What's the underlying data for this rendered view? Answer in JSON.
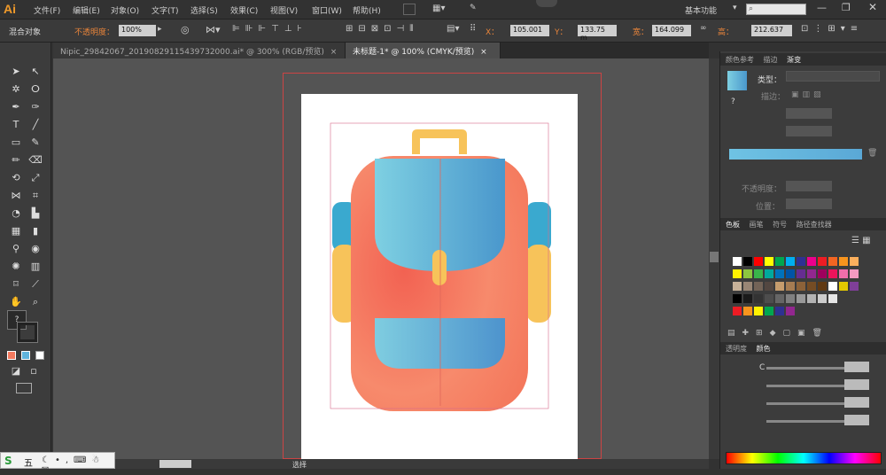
{
  "menu": {
    "logo": "Ai",
    "items": [
      "文件(F)",
      "编辑(E)",
      "对象(O)",
      "文字(T)",
      "选择(S)",
      "效果(C)",
      "视图(V)",
      "窗口(W)",
      "帮助(H)"
    ],
    "workspace": "基本功能",
    "search_placeholder": ""
  },
  "control": {
    "selection_label": "混合对象",
    "opacity_label": "不透明度：",
    "opacity_value": "100%",
    "x_label": "X：",
    "x_value": "105.001",
    "y_label": "Y：",
    "y_value": "133.75 m",
    "w_label": "宽：",
    "w_value": "164.099",
    "h_label": "高：",
    "h_value": "212.637"
  },
  "tabs": [
    {
      "label": "Nipic_29842067_20190829115439732000.ai* @ 300% (RGB/预览)",
      "close": "×"
    },
    {
      "label": "未标题-1* @ 100% (CMYK/预览)",
      "close": "×"
    }
  ],
  "gradient_panel": {
    "tabs": [
      "颜色参考",
      "描边",
      "渐变"
    ],
    "type_label": "类型：",
    "stroke_label": "描边：",
    "opacity_label": "不透明度：",
    "position_label": "位置：",
    "question": "?"
  },
  "swatches_panel": {
    "tabs": [
      "色板",
      "画笔",
      "符号",
      "路径查找器"
    ]
  },
  "color_panel": {
    "tabs": [
      "透明度",
      "颜色"
    ],
    "channel_c": "C"
  },
  "status": {
    "tool_label": "选择"
  },
  "taskbar": {
    "ime": "五"
  },
  "colors": {
    "bag_body": "#f47a5f",
    "bag_pocket": "#5fb4dd",
    "bag_strap": "#f7c35a",
    "side_top": "#3aa9cf"
  },
  "swatch_rows": [
    [
      "#ffffff",
      "#000000",
      "#ff0000",
      "#ffff00",
      "#00a650",
      "#00aeef",
      "#2e3192",
      "#ec008c",
      "#ed1c24",
      "#f26522",
      "#f7941d",
      "#fbaf5d"
    ],
    [
      "#fff200",
      "#8dc63f",
      "#39b54a",
      "#00a99d",
      "#0072bc",
      "#0054a6",
      "#662d91",
      "#92278f",
      "#9e005d",
      "#ed145b",
      "#f06eaa",
      "#f49ac1"
    ],
    [
      "#c7b299",
      "#998675",
      "#736357",
      "#534741",
      "#c69c6d",
      "#a67c52",
      "#8c6239",
      "#754c24",
      "#603913",
      "#ffffff",
      "#e3c800",
      "#7f3f98"
    ],
    [
      "#000000",
      "#1a1a1a",
      "#333333",
      "#4d4d4d",
      "#666666",
      "#808080",
      "#999999",
      "#b3b3b3",
      "#cccccc",
      "#e6e6e6"
    ],
    [
      "#ed1c24",
      "#f7941d",
      "#fff200",
      "#00a650",
      "#2e3192",
      "#92278f"
    ]
  ]
}
